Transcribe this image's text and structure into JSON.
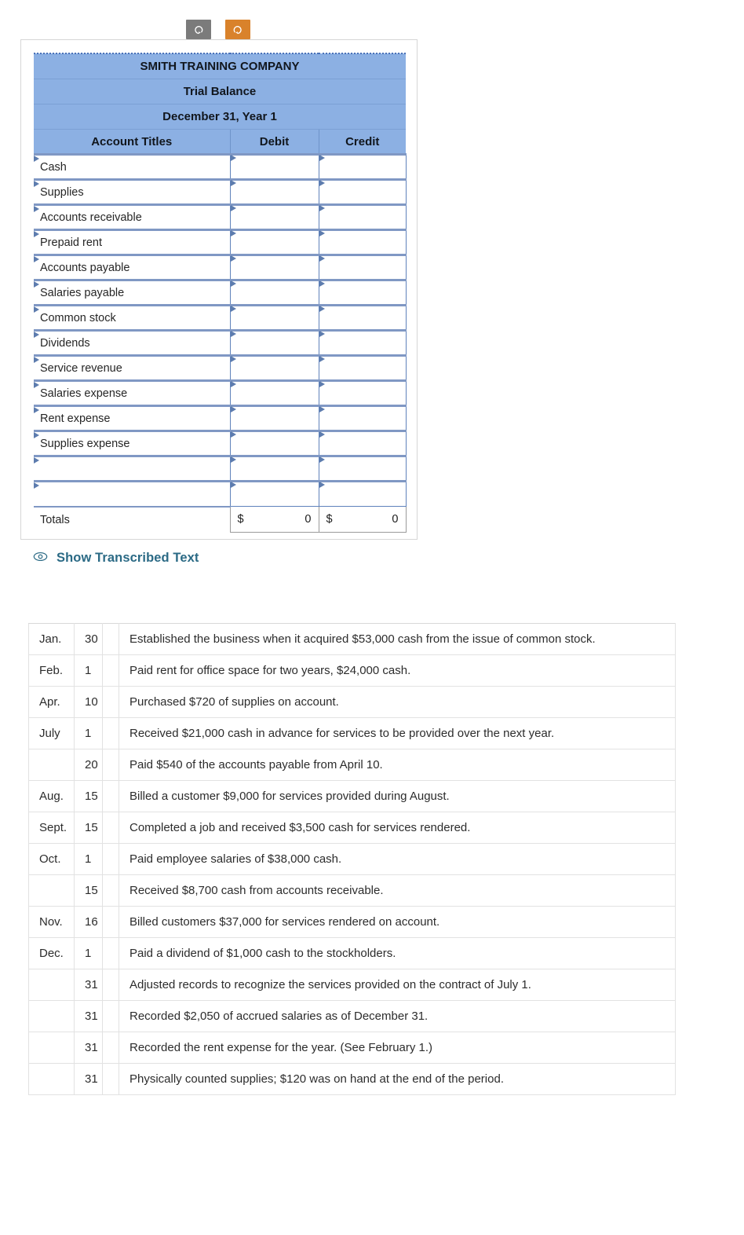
{
  "toolbar": {
    "undo": {
      "name": "undo-button",
      "icon": "undo-arrow-icon",
      "color": "#7b7b7b",
      "title": "Undo"
    },
    "redo": {
      "name": "redo-button",
      "icon": "redo-arrow-icon",
      "color": "#d9822b",
      "title": "Redo"
    }
  },
  "worksheet": {
    "header_color": "#8cb0e3",
    "company": "SMITH TRAINING COMPANY",
    "statement": "Trial Balance",
    "date": "December 31, Year 1",
    "columns": {
      "accounts": "Account Titles",
      "debit": "Debit",
      "credit": "Credit"
    },
    "rows": [
      {
        "account": "Cash",
        "debit": "",
        "credit": ""
      },
      {
        "account": "Supplies",
        "debit": "",
        "credit": ""
      },
      {
        "account": "Accounts receivable",
        "debit": "",
        "credit": ""
      },
      {
        "account": "Prepaid rent",
        "debit": "",
        "credit": ""
      },
      {
        "account": "Accounts payable",
        "debit": "",
        "credit": ""
      },
      {
        "account": "Salaries payable",
        "debit": "",
        "credit": ""
      },
      {
        "account": "Common stock",
        "debit": "",
        "credit": ""
      },
      {
        "account": "Dividends",
        "debit": "",
        "credit": ""
      },
      {
        "account": "Service revenue",
        "debit": "",
        "credit": ""
      },
      {
        "account": "Salaries expense",
        "debit": "",
        "credit": ""
      },
      {
        "account": "Rent expense",
        "debit": "",
        "credit": ""
      },
      {
        "account": "Supplies expense",
        "debit": "",
        "credit": ""
      },
      {
        "account": "",
        "debit": "",
        "credit": ""
      },
      {
        "account": "",
        "debit": "",
        "credit": ""
      }
    ],
    "totals": {
      "label": "Totals",
      "debit_symbol": "$",
      "debit_value": "0",
      "credit_symbol": "$",
      "credit_value": "0"
    }
  },
  "transcribe": {
    "label": "Show Transcribed Text",
    "icon": "eye-icon",
    "color": "#2b6a85"
  },
  "transactions": [
    {
      "month": "Jan.",
      "day": "30",
      "description": "Established the business when it acquired $53,000 cash from the issue of common stock."
    },
    {
      "month": "Feb.",
      "day": "1",
      "description": "Paid rent for office space for two years, $24,000 cash."
    },
    {
      "month": "Apr.",
      "day": "10",
      "description": "Purchased $720 of supplies on account."
    },
    {
      "month": "July",
      "day": "1",
      "description": "Received $21,000 cash in advance for services to be provided over the next year."
    },
    {
      "month": "",
      "day": "20",
      "description": "Paid $540 of the accounts payable from April 10."
    },
    {
      "month": "Aug.",
      "day": "15",
      "description": "Billed a customer $9,000 for services provided during August."
    },
    {
      "month": "Sept.",
      "day": "15",
      "description": "Completed a job and received $3,500 cash for services rendered."
    },
    {
      "month": "Oct.",
      "day": "1",
      "description": "Paid employee salaries of $38,000 cash."
    },
    {
      "month": "",
      "day": "15",
      "description": "Received $8,700 cash from accounts receivable."
    },
    {
      "month": "Nov.",
      "day": "16",
      "description": "Billed customers $37,000 for services rendered on account."
    },
    {
      "month": "Dec.",
      "day": "1",
      "description": "Paid a dividend of $1,000 cash to the stockholders."
    },
    {
      "month": "",
      "day": "31",
      "description": "Adjusted records to recognize the services provided on the contract of July 1."
    },
    {
      "month": "",
      "day": "31",
      "description": "Recorded $2,050 of accrued salaries as of December 31."
    },
    {
      "month": "",
      "day": "31",
      "description": "Recorded the rent expense for the year. (See February 1.)"
    },
    {
      "month": "",
      "day": "31",
      "description": "Physically counted supplies; $120 was on hand at the end of the period."
    }
  ]
}
